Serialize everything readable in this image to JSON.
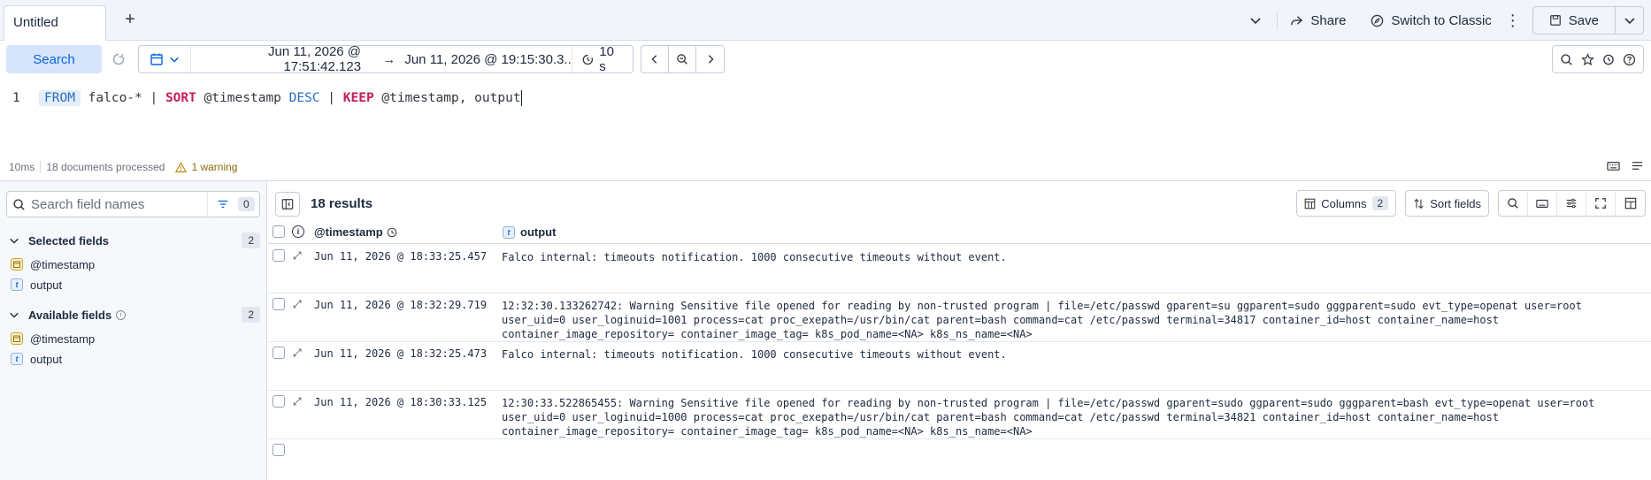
{
  "tabs": {
    "active_label": "Untitled"
  },
  "top_actions": {
    "share": "Share",
    "switch_classic": "Switch to Classic",
    "save": "Save"
  },
  "toolbar": {
    "search_label": "Search",
    "date_start": "Jun 11, 2026 @ 17:51:42.123",
    "date_end": "Jun 11, 2026 @ 19:15:30.3...",
    "refresh_interval": "10 s"
  },
  "editor": {
    "line_number": "1",
    "tokens": {
      "from": "FROM",
      "source": " falco-* | ",
      "sort": "SORT",
      "sort_field": " @timestamp ",
      "desc": "DESC",
      "pipe": " | ",
      "keep": "KEEP",
      "keep_fields": " @timestamp, output"
    }
  },
  "status": {
    "time": "10ms",
    "docs": "18 documents processed",
    "warning": "1 warning"
  },
  "sidebar": {
    "search_placeholder": "Search field names",
    "filter_count": "0",
    "selected": {
      "label": "Selected fields",
      "count": "2",
      "fields": [
        "@timestamp",
        "output"
      ]
    },
    "available": {
      "label": "Available fields",
      "count": "2",
      "fields": [
        "@timestamp",
        "output"
      ]
    }
  },
  "grid": {
    "results": "18 results",
    "columns_label": "Columns",
    "columns_count": "2",
    "sort_label": "Sort fields",
    "headers": {
      "timestamp": "@timestamp",
      "output": "output"
    },
    "rows": [
      {
        "timestamp": "Jun 11, 2026 @ 18:33:25.457",
        "output": "Falco internal: timeouts notification. 1000 consecutive timeouts without event."
      },
      {
        "timestamp": "Jun 11, 2026 @ 18:32:29.719",
        "output": "12:32:30.133262742: Warning Sensitive file opened for reading by non-trusted program | file=/etc/passwd gparent=su ggparent=sudo gggparent=sudo evt_type=openat user=root user_uid=0 user_loginuid=1001 process=cat proc_exepath=/usr/bin/cat parent=bash command=cat /etc/passwd terminal=34817 container_id=host container_name=host container_image_repository= container_image_tag= k8s_pod_name=<NA> k8s_ns_name=<NA>"
      },
      {
        "timestamp": "Jun 11, 2026 @ 18:32:25.473",
        "output": "Falco internal: timeouts notification. 1000 consecutive timeouts without event."
      },
      {
        "timestamp": "Jun 11, 2026 @ 18:30:33.125",
        "output": "12:30:33.522865455: Warning Sensitive file opened for reading by non-trusted program | file=/etc/passwd gparent=sudo ggparent=sudo gggparent=bash evt_type=openat user=root user_uid=0 user_loginuid=1000 process=cat proc_exepath=/usr/bin/cat parent=bash command=cat /etc/passwd terminal=34821 container_id=host container_name=host container_image_repository= container_image_tag= k8s_pod_name=<NA> k8s_ns_name=<NA>"
      }
    ]
  }
}
